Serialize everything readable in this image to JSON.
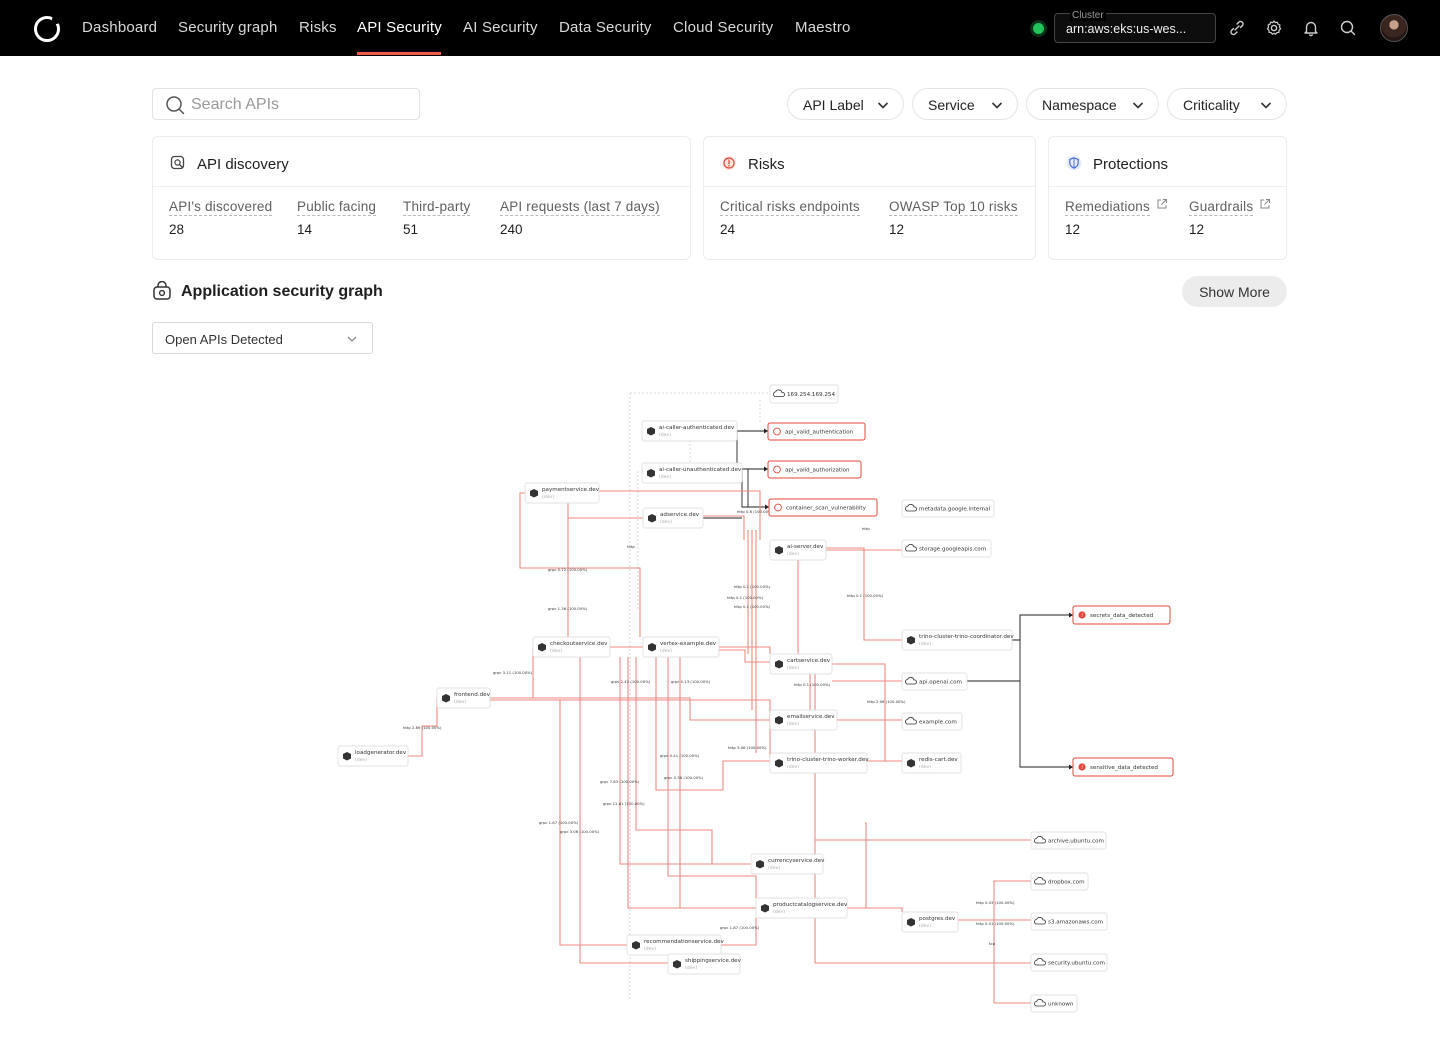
{
  "nav": {
    "items": [
      {
        "label": "Dashboard",
        "active": false
      },
      {
        "label": "Security graph",
        "active": false
      },
      {
        "label": "Risks",
        "active": false
      },
      {
        "label": "API Security",
        "active": true
      },
      {
        "label": "AI Security",
        "active": false
      },
      {
        "label": "Data Security",
        "active": false
      },
      {
        "label": "Cloud Security",
        "active": false
      },
      {
        "label": "Maestro",
        "active": false
      }
    ],
    "cluster": {
      "label": "Cluster",
      "value": "arn:aws:eks:us-wes..."
    }
  },
  "filters": {
    "search_placeholder": "Search APIs",
    "dropdowns": [
      {
        "label": "API Label"
      },
      {
        "label": "Service"
      },
      {
        "label": "Namespace"
      },
      {
        "label": "Criticality"
      }
    ]
  },
  "cards": {
    "discovery": {
      "title": "API discovery",
      "metrics": [
        {
          "label": "API's discovered",
          "value": "28"
        },
        {
          "label": "Public facing",
          "value": "14"
        },
        {
          "label": "Third-party",
          "value": "51"
        },
        {
          "label": "API requests (last 7 days)",
          "value": "240"
        }
      ]
    },
    "risks": {
      "title": "Risks",
      "metrics": [
        {
          "label": "Critical risks endpoints",
          "value": "24"
        },
        {
          "label": "OWASP Top 10 risks",
          "value": "12"
        }
      ]
    },
    "protections": {
      "title": "Protections",
      "metrics": [
        {
          "label": "Remediations",
          "value": "12"
        },
        {
          "label": "Guardrails",
          "value": "12"
        }
      ]
    }
  },
  "graph_section": {
    "title": "Application security graph",
    "show_more": "Show More",
    "view_select": "Open APIs Detected"
  },
  "colors": {
    "accent": "#f05a4a",
    "edge": "#f08a80",
    "nav_bg": "#000000",
    "status_ok": "#21c35b",
    "risk": "#e5483a"
  },
  "graph": {
    "nodes": [
      {
        "id": "n169",
        "type": "external",
        "label": "169.254.169.254"
      },
      {
        "id": "callerAuth",
        "type": "service",
        "label": "ai-caller-authenticated.dev",
        "sub": "(dev)"
      },
      {
        "id": "callerUnauth",
        "type": "service",
        "label": "ai-caller-unauthenticated.dev",
        "sub": "(dev)"
      },
      {
        "id": "payment",
        "type": "service",
        "label": "paymentservice.dev",
        "sub": "(dev)"
      },
      {
        "id": "adservice",
        "type": "service",
        "label": "adservice.dev",
        "sub": "(dev)"
      },
      {
        "id": "aiserver",
        "type": "service",
        "label": "ai-server.dev",
        "sub": "(dev)"
      },
      {
        "id": "checkout",
        "type": "service",
        "label": "checkoutservice.dev",
        "sub": "(dev)"
      },
      {
        "id": "vertex",
        "type": "service",
        "label": "vertex-example.dev",
        "sub": "(dev)"
      },
      {
        "id": "cart",
        "type": "service",
        "label": "cartservice.dev",
        "sub": "(dev)"
      },
      {
        "id": "frontend",
        "type": "service",
        "label": "frontend.dev",
        "sub": "(dev)"
      },
      {
        "id": "loadgen",
        "type": "service",
        "label": "loadgenerator.dev",
        "sub": "(dev)"
      },
      {
        "id": "email",
        "type": "service",
        "label": "emailservice.dev",
        "sub": "(dev)"
      },
      {
        "id": "trinoWorker",
        "type": "service",
        "label": "trino-cluster-trino-worker.dev",
        "sub": "(dev)"
      },
      {
        "id": "trinoCoord",
        "type": "service",
        "label": "trino-cluster-trino-coordinator.dev",
        "sub": "(dev)"
      },
      {
        "id": "redis",
        "type": "service",
        "label": "redis-cart.dev",
        "sub": "(dev)"
      },
      {
        "id": "currency",
        "type": "service",
        "label": "currencyservice.dev",
        "sub": "(dev)"
      },
      {
        "id": "productcat",
        "type": "service",
        "label": "productcatalogservice.dev",
        "sub": "(dev)"
      },
      {
        "id": "recommend",
        "type": "service",
        "label": "recommendationservice.dev",
        "sub": "(dev)"
      },
      {
        "id": "shipping",
        "type": "service",
        "label": "shippingservice.dev",
        "sub": "(dev)"
      },
      {
        "id": "postgres",
        "type": "service",
        "label": "postgres.dev",
        "sub": "(dev)"
      },
      {
        "id": "metadata",
        "type": "external",
        "label": "metadata.google.internal"
      },
      {
        "id": "storage",
        "type": "external",
        "label": "storage.googleapis.com"
      },
      {
        "id": "openai",
        "type": "external",
        "label": "api.openai.com"
      },
      {
        "id": "example",
        "type": "external",
        "label": "example.com"
      },
      {
        "id": "archive",
        "type": "external",
        "label": "archive.ubuntu.com"
      },
      {
        "id": "dropbox",
        "type": "external",
        "label": "dropbox.com"
      },
      {
        "id": "s3",
        "type": "external",
        "label": "s3.amazonaws.com"
      },
      {
        "id": "secubuntu",
        "type": "external",
        "label": "security.ubuntu.com"
      },
      {
        "id": "unknown",
        "type": "external",
        "label": "unknown"
      },
      {
        "id": "validAuthn",
        "type": "risk",
        "label": "api_valid_authentication"
      },
      {
        "id": "validAuthz",
        "type": "risk",
        "label": "api_valid_authorization"
      },
      {
        "id": "containerVuln",
        "type": "risk",
        "label": "container_scan_vulnerability"
      },
      {
        "id": "secrets",
        "type": "finding",
        "label": "secrets_data_detected"
      },
      {
        "id": "sensitive",
        "type": "finding",
        "label": "sensitive_data_detected"
      }
    ],
    "edge_labels": [
      "grpc 0.72 (100.00%)",
      "grpc 1.36 (100.00%)",
      "grpc 3.11 (100.00%)",
      "grpc 2.42 (100.00%)",
      "grpc 0.13 (100.00%)",
      "http 2.69 (100.00%)",
      "http 0.1 (100.00%)",
      "http 0.1 (100.00%)",
      "http 0.1 (100.00%)",
      "http 0.1 (100.00%)",
      "http 0.1 (100.00%)",
      "http 2.96 (100.00%)",
      "http 3.06 (100.00%)",
      "grpc 0.41 (100.00%)",
      "grpc 7.83 (100.00%)",
      "grpc 0.38 (100.00%)",
      "grpc 12.81 (100.00%)",
      "grpc 1.67 (100.00%)",
      "grpc 3.06 (100.00%)",
      "grpc 1.87 (100.00%)",
      "http 0.03 (100.00%)",
      "http 0.01 (100.00%)",
      "http 0.6 (100.00%)",
      "http",
      "http",
      "tcp"
    ]
  }
}
